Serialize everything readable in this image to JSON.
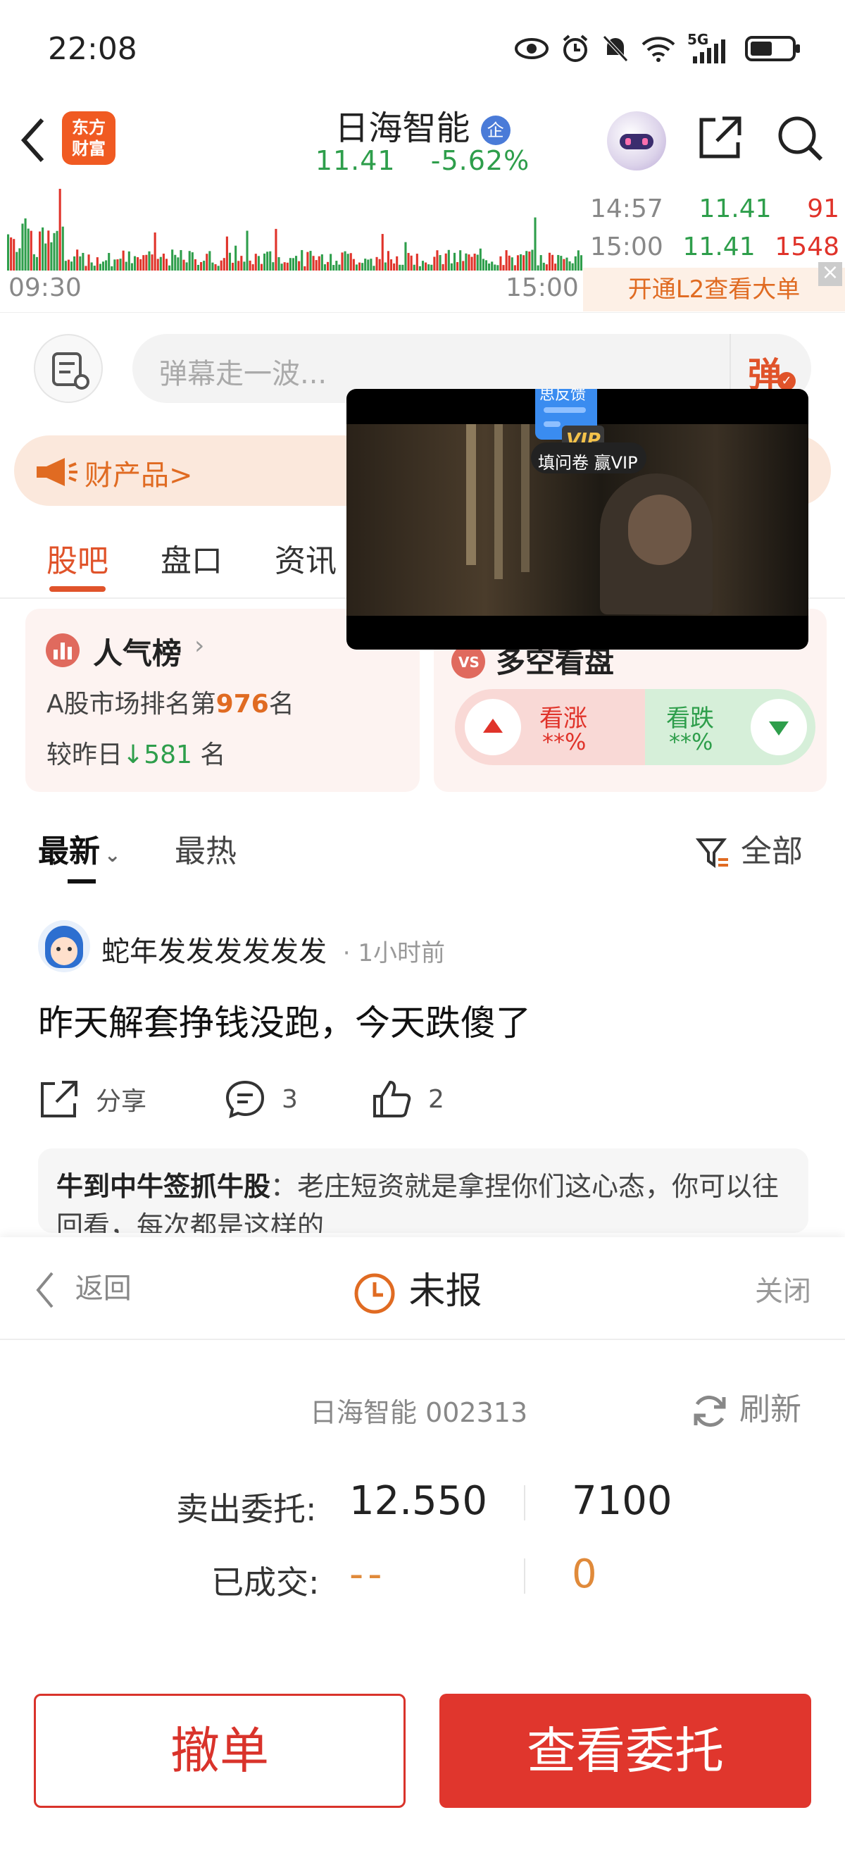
{
  "status_bar": {
    "time": "22:08",
    "network": "5G"
  },
  "header": {
    "app_logo_line1": "东方",
    "app_logo_line2": "财富",
    "stock_name": "日海智能",
    "badge": "企",
    "price": "11.41",
    "change": "-5.62%"
  },
  "mini_chart": {
    "time_start": "09:30",
    "time_end": "15:00",
    "ticks": [
      {
        "time": "14:57",
        "price": "11.41",
        "volume": "91"
      },
      {
        "time": "15:00",
        "price": "11.41",
        "volume": "1548"
      }
    ],
    "l2_promo": "开通L2查看大单"
  },
  "barrage": {
    "placeholder": "弹幕走一波...",
    "button": "弹"
  },
  "promo": {
    "text": "财产品>"
  },
  "tabs": [
    {
      "label": "股吧"
    },
    {
      "label": "盘口"
    },
    {
      "label": "资讯"
    }
  ],
  "video_popup": {
    "badge": "VIP",
    "caption": "填问卷 赢VIP",
    "top_text": "思反馈"
  },
  "popularity": {
    "title": "人气榜",
    "rank_prefix": "A股市场排名第",
    "rank": "976",
    "rank_suffix": "名",
    "compare_prefix": "较昨日",
    "compare_value": "581",
    "compare_suffix": "名"
  },
  "sentiment": {
    "title": "多空看盘",
    "up_label": "看涨",
    "up_value": "**%",
    "down_label": "看跌",
    "down_value": "**%"
  },
  "sort": {
    "latest": "最新",
    "hot": "最热",
    "filter": "全部"
  },
  "post": {
    "username": "蛇年发发发发发发",
    "time": "· 1小时前",
    "body": "昨天解套挣钱没跑，今天跌傻了",
    "share_label": "分享",
    "comments": "3",
    "likes": "2",
    "reply_user": "牛到中牛签抓牛股",
    "reply_text": "：老庄短资就是拿捏你们这心态，你可以往回看，每次都是这样的"
  },
  "order_sheet": {
    "back": "返回",
    "status": "未报",
    "close": "关闭",
    "stock_info": "日海智能 002313",
    "refresh": "刷新",
    "sell_label": "卖出委托:",
    "sell_price": "12.550",
    "sell_qty": "7100",
    "filled_label": "已成交:",
    "filled_price": "--",
    "filled_qty": "0",
    "cancel_btn": "撤单",
    "view_btn": "查看委托"
  },
  "colors": {
    "accent": "#e0362d",
    "down": "#2e9e4b",
    "orange": "#e06b22"
  }
}
